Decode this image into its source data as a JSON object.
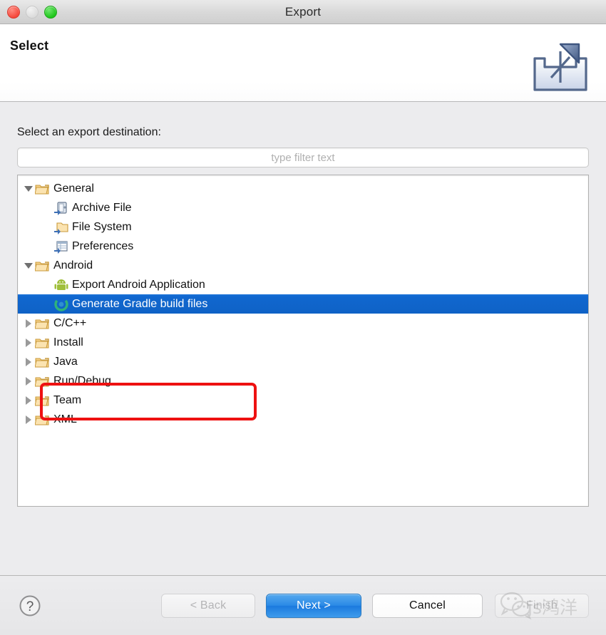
{
  "window": {
    "title": "Export",
    "traffic_lights": [
      {
        "name": "close-button",
        "color": "#f5483c"
      },
      {
        "name": "minimize-button",
        "color": "#dcdcdc"
      },
      {
        "name": "maximize-button",
        "color": "#1fc61b"
      }
    ]
  },
  "header": {
    "title": "Select",
    "icon": "export-icon"
  },
  "body": {
    "destination_label": "Select an export destination:",
    "filter": {
      "value": "",
      "placeholder": "type filter text"
    }
  },
  "tree": {
    "items": [
      {
        "label": "General",
        "icon": "folder-icon",
        "twisty": "expanded",
        "indent": 1,
        "selected": false
      },
      {
        "label": "Archive File",
        "icon": "archive-file-icon",
        "twisty": "none",
        "indent": 2,
        "selected": false
      },
      {
        "label": "File System",
        "icon": "file-system-icon",
        "twisty": "none",
        "indent": 2,
        "selected": false
      },
      {
        "label": "Preferences",
        "icon": "preferences-icon",
        "twisty": "none",
        "indent": 2,
        "selected": false
      },
      {
        "label": "Android",
        "icon": "folder-icon",
        "twisty": "expanded",
        "indent": 1,
        "selected": false
      },
      {
        "label": "Export Android Application",
        "icon": "android-icon",
        "twisty": "none",
        "indent": 2,
        "selected": false
      },
      {
        "label": "Generate Gradle build files",
        "icon": "gradle-icon",
        "twisty": "none",
        "indent": 2,
        "selected": true
      },
      {
        "label": "C/C++",
        "icon": "folder-icon",
        "twisty": "collapsed",
        "indent": 1,
        "selected": false
      },
      {
        "label": "Install",
        "icon": "folder-icon",
        "twisty": "collapsed",
        "indent": 1,
        "selected": false
      },
      {
        "label": "Java",
        "icon": "folder-icon",
        "twisty": "collapsed",
        "indent": 1,
        "selected": false
      },
      {
        "label": "Run/Debug",
        "icon": "folder-icon",
        "twisty": "collapsed",
        "indent": 1,
        "selected": false
      },
      {
        "label": "Team",
        "icon": "folder-icon",
        "twisty": "collapsed",
        "indent": 1,
        "selected": false
      },
      {
        "label": "XML",
        "icon": "folder-icon",
        "twisty": "collapsed",
        "indent": 1,
        "selected": false
      }
    ],
    "selection_color": "#1067cf"
  },
  "annotation": {
    "shape": "rectangle",
    "color": "#ee1111"
  },
  "footer": {
    "help_label": "?",
    "back_label": "< Back",
    "next_label": "Next >",
    "cancel_label": "Cancel",
    "finish_label": "Finish"
  },
  "watermark": {
    "text": "js鸿洋",
    "icon": "wechat-icon"
  }
}
